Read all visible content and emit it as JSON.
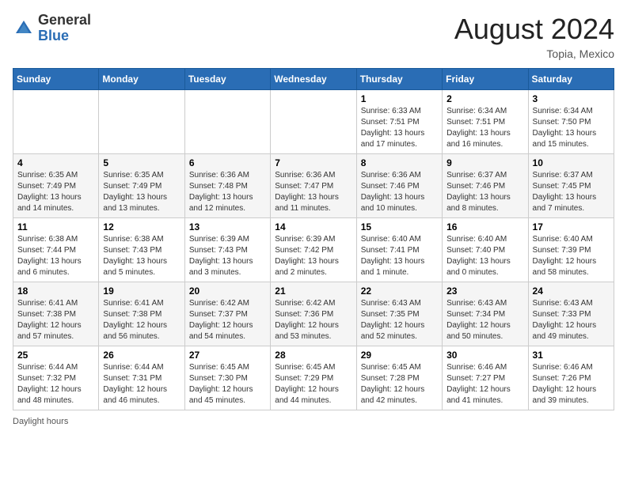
{
  "header": {
    "logo_general": "General",
    "logo_blue": "Blue",
    "month_year": "August 2024",
    "location": "Topia, Mexico"
  },
  "footer": {
    "daylight_label": "Daylight hours"
  },
  "days_of_week": [
    "Sunday",
    "Monday",
    "Tuesday",
    "Wednesday",
    "Thursday",
    "Friday",
    "Saturday"
  ],
  "weeks": [
    [
      {
        "day": "",
        "info": ""
      },
      {
        "day": "",
        "info": ""
      },
      {
        "day": "",
        "info": ""
      },
      {
        "day": "",
        "info": ""
      },
      {
        "day": "1",
        "info": "Sunrise: 6:33 AM\nSunset: 7:51 PM\nDaylight: 13 hours\nand 17 minutes."
      },
      {
        "day": "2",
        "info": "Sunrise: 6:34 AM\nSunset: 7:51 PM\nDaylight: 13 hours\nand 16 minutes."
      },
      {
        "day": "3",
        "info": "Sunrise: 6:34 AM\nSunset: 7:50 PM\nDaylight: 13 hours\nand 15 minutes."
      }
    ],
    [
      {
        "day": "4",
        "info": "Sunrise: 6:35 AM\nSunset: 7:49 PM\nDaylight: 13 hours\nand 14 minutes."
      },
      {
        "day": "5",
        "info": "Sunrise: 6:35 AM\nSunset: 7:49 PM\nDaylight: 13 hours\nand 13 minutes."
      },
      {
        "day": "6",
        "info": "Sunrise: 6:36 AM\nSunset: 7:48 PM\nDaylight: 13 hours\nand 12 minutes."
      },
      {
        "day": "7",
        "info": "Sunrise: 6:36 AM\nSunset: 7:47 PM\nDaylight: 13 hours\nand 11 minutes."
      },
      {
        "day": "8",
        "info": "Sunrise: 6:36 AM\nSunset: 7:46 PM\nDaylight: 13 hours\nand 10 minutes."
      },
      {
        "day": "9",
        "info": "Sunrise: 6:37 AM\nSunset: 7:46 PM\nDaylight: 13 hours\nand 8 minutes."
      },
      {
        "day": "10",
        "info": "Sunrise: 6:37 AM\nSunset: 7:45 PM\nDaylight: 13 hours\nand 7 minutes."
      }
    ],
    [
      {
        "day": "11",
        "info": "Sunrise: 6:38 AM\nSunset: 7:44 PM\nDaylight: 13 hours\nand 6 minutes."
      },
      {
        "day": "12",
        "info": "Sunrise: 6:38 AM\nSunset: 7:43 PM\nDaylight: 13 hours\nand 5 minutes."
      },
      {
        "day": "13",
        "info": "Sunrise: 6:39 AM\nSunset: 7:43 PM\nDaylight: 13 hours\nand 3 minutes."
      },
      {
        "day": "14",
        "info": "Sunrise: 6:39 AM\nSunset: 7:42 PM\nDaylight: 13 hours\nand 2 minutes."
      },
      {
        "day": "15",
        "info": "Sunrise: 6:40 AM\nSunset: 7:41 PM\nDaylight: 13 hours\nand 1 minute."
      },
      {
        "day": "16",
        "info": "Sunrise: 6:40 AM\nSunset: 7:40 PM\nDaylight: 13 hours\nand 0 minutes."
      },
      {
        "day": "17",
        "info": "Sunrise: 6:40 AM\nSunset: 7:39 PM\nDaylight: 12 hours\nand 58 minutes."
      }
    ],
    [
      {
        "day": "18",
        "info": "Sunrise: 6:41 AM\nSunset: 7:38 PM\nDaylight: 12 hours\nand 57 minutes."
      },
      {
        "day": "19",
        "info": "Sunrise: 6:41 AM\nSunset: 7:38 PM\nDaylight: 12 hours\nand 56 minutes."
      },
      {
        "day": "20",
        "info": "Sunrise: 6:42 AM\nSunset: 7:37 PM\nDaylight: 12 hours\nand 54 minutes."
      },
      {
        "day": "21",
        "info": "Sunrise: 6:42 AM\nSunset: 7:36 PM\nDaylight: 12 hours\nand 53 minutes."
      },
      {
        "day": "22",
        "info": "Sunrise: 6:43 AM\nSunset: 7:35 PM\nDaylight: 12 hours\nand 52 minutes."
      },
      {
        "day": "23",
        "info": "Sunrise: 6:43 AM\nSunset: 7:34 PM\nDaylight: 12 hours\nand 50 minutes."
      },
      {
        "day": "24",
        "info": "Sunrise: 6:43 AM\nSunset: 7:33 PM\nDaylight: 12 hours\nand 49 minutes."
      }
    ],
    [
      {
        "day": "25",
        "info": "Sunrise: 6:44 AM\nSunset: 7:32 PM\nDaylight: 12 hours\nand 48 minutes."
      },
      {
        "day": "26",
        "info": "Sunrise: 6:44 AM\nSunset: 7:31 PM\nDaylight: 12 hours\nand 46 minutes."
      },
      {
        "day": "27",
        "info": "Sunrise: 6:45 AM\nSunset: 7:30 PM\nDaylight: 12 hours\nand 45 minutes."
      },
      {
        "day": "28",
        "info": "Sunrise: 6:45 AM\nSunset: 7:29 PM\nDaylight: 12 hours\nand 44 minutes."
      },
      {
        "day": "29",
        "info": "Sunrise: 6:45 AM\nSunset: 7:28 PM\nDaylight: 12 hours\nand 42 minutes."
      },
      {
        "day": "30",
        "info": "Sunrise: 6:46 AM\nSunset: 7:27 PM\nDaylight: 12 hours\nand 41 minutes."
      },
      {
        "day": "31",
        "info": "Sunrise: 6:46 AM\nSunset: 7:26 PM\nDaylight: 12 hours\nand 39 minutes."
      }
    ]
  ]
}
